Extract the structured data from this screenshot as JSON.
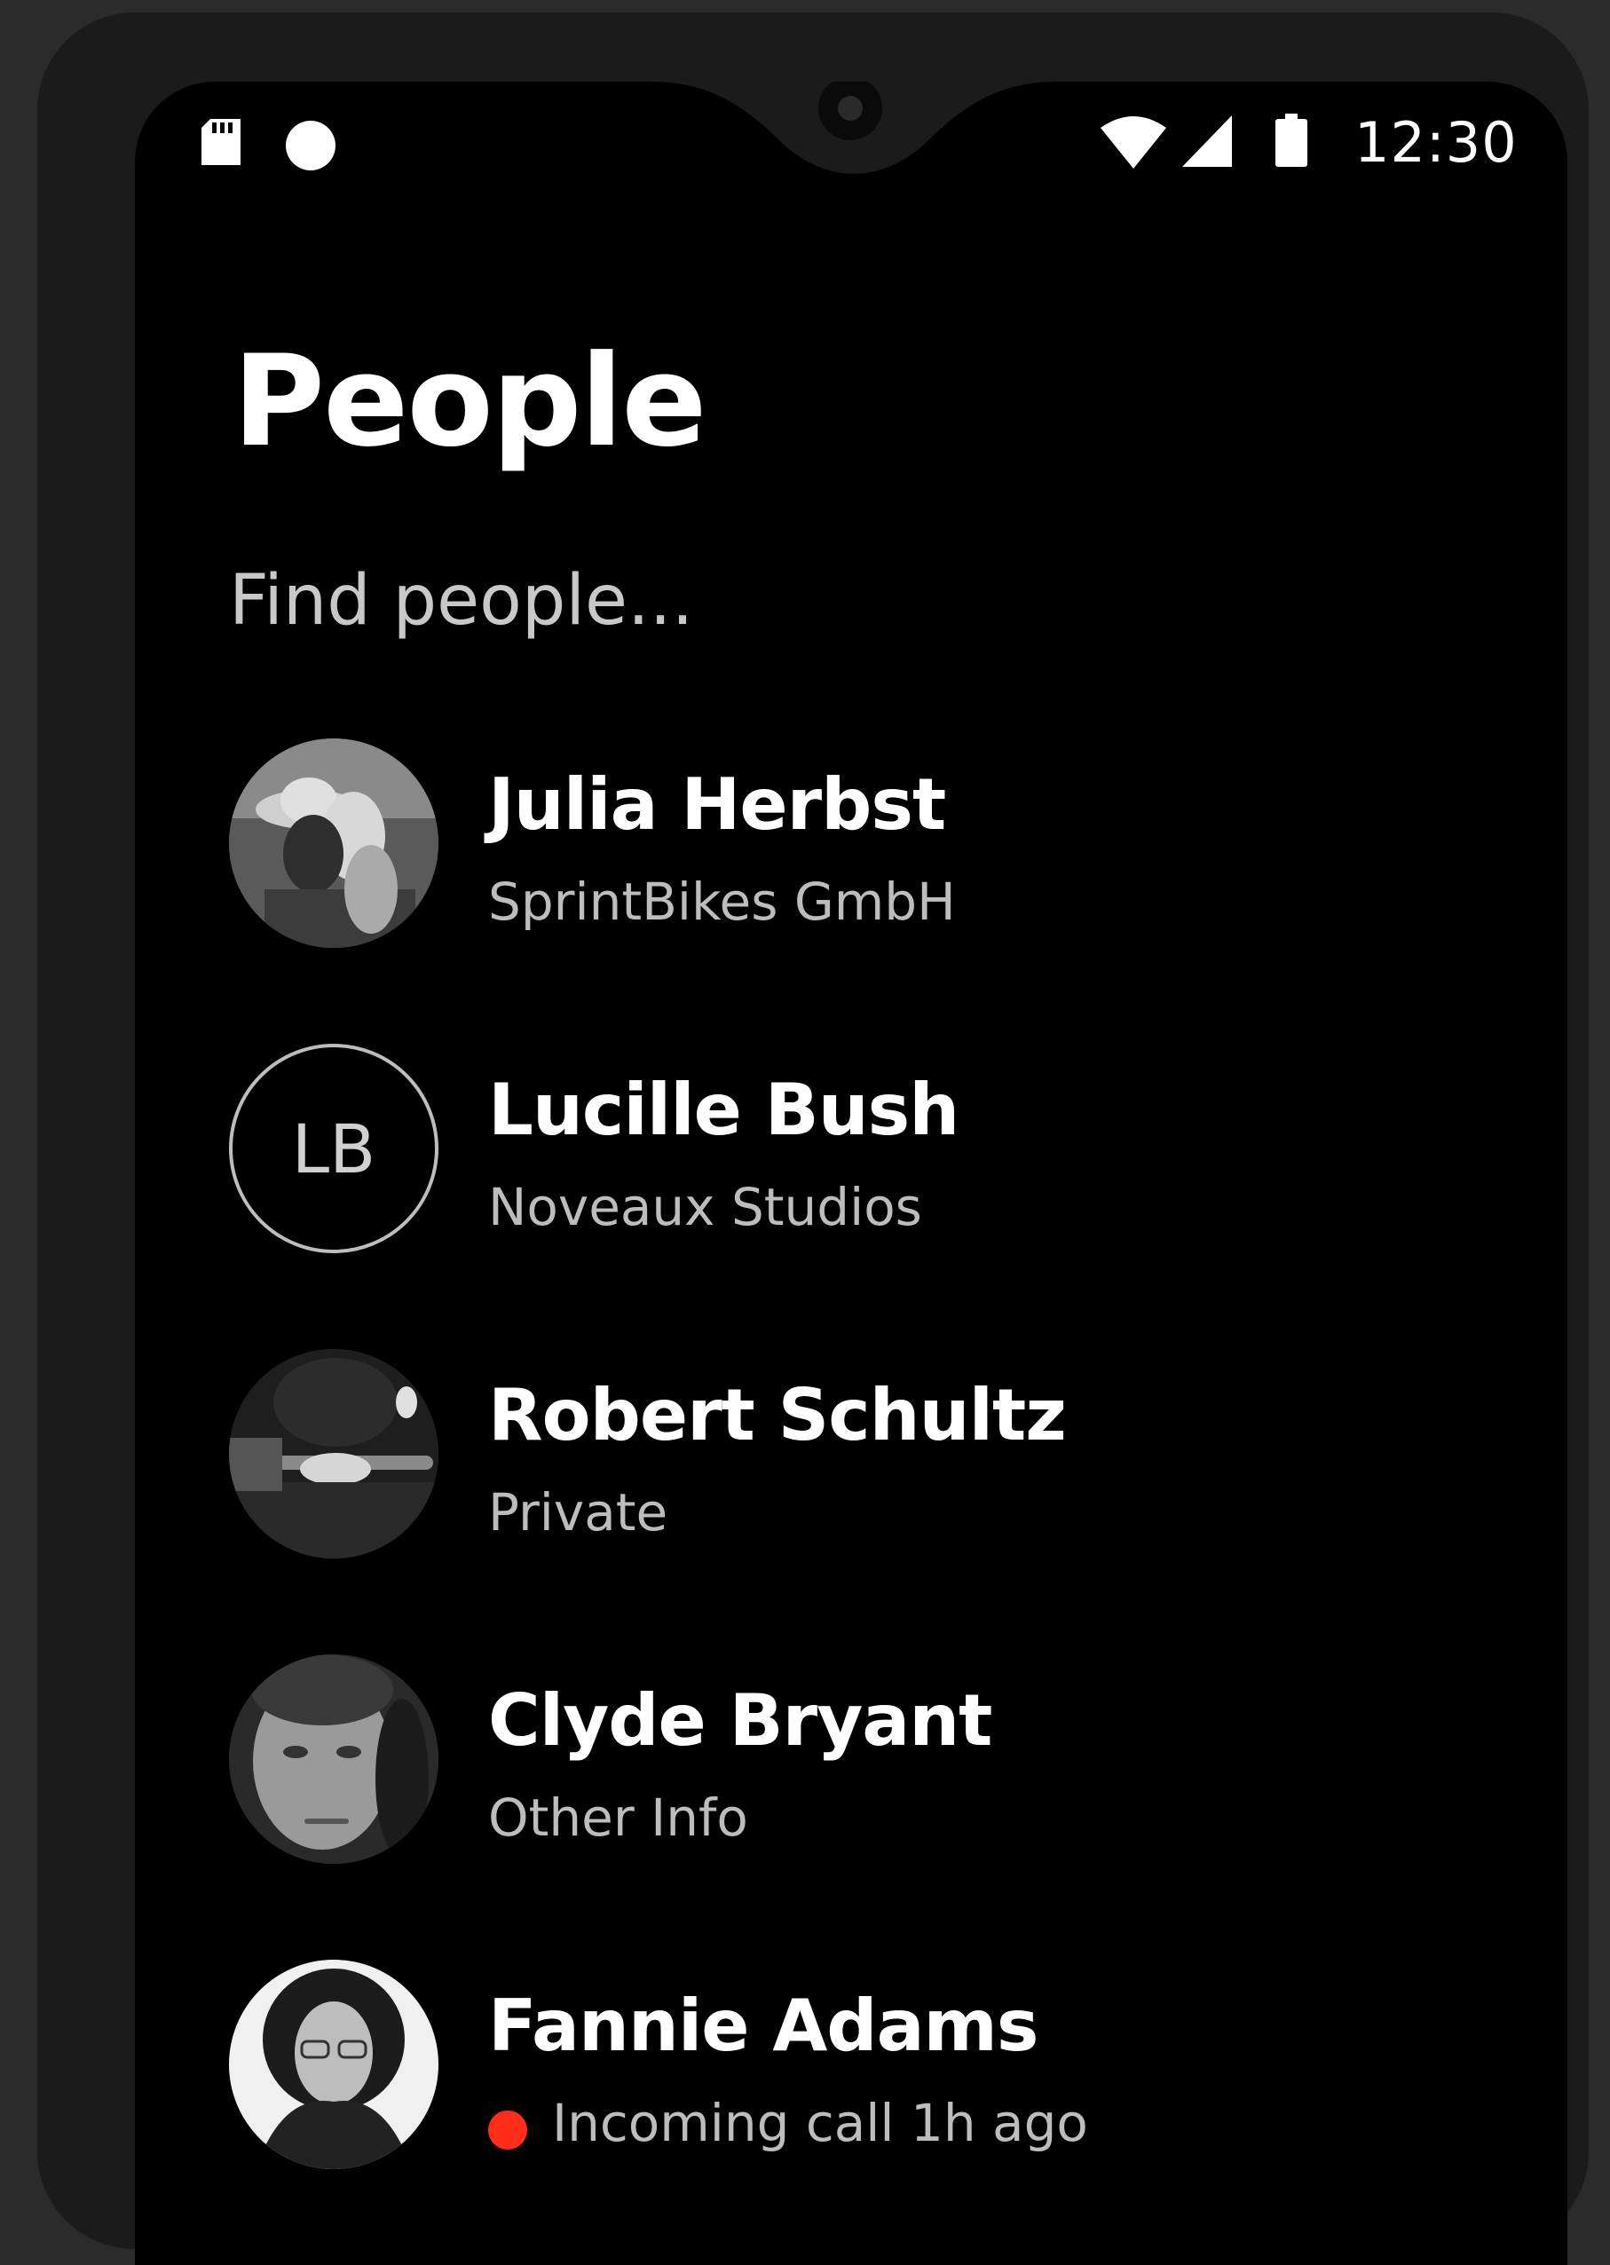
{
  "status_bar": {
    "time": "12:30",
    "left_icons": [
      "sd-card-icon",
      "notification-dot-icon"
    ],
    "right_icons": [
      "wifi-icon",
      "cellular-signal-icon",
      "battery-icon"
    ]
  },
  "page": {
    "title": "People",
    "search_placeholder": "Find people..."
  },
  "people": [
    {
      "name": "Julia Herbst",
      "subtitle": "SprintBikes GmbH",
      "avatar": "photo"
    },
    {
      "name": "Lucille Bush",
      "subtitle": "Noveaux Studios",
      "avatar": "initials",
      "initials": "LB"
    },
    {
      "name": "Robert Schultz",
      "subtitle": "Private",
      "avatar": "photo"
    },
    {
      "name": "Clyde Bryant",
      "subtitle": "Other Info",
      "avatar": "photo"
    },
    {
      "name": "Fannie Adams",
      "subtitle": "Incoming call 1h ago",
      "avatar": "photo",
      "status_color": "#ff2d1a"
    }
  ],
  "colors": {
    "background": "#000000",
    "frame": "#1b1b1b",
    "text_primary": "#ffffff",
    "text_secondary": "#bdbdbd",
    "missed_call": "#ff2d1a"
  }
}
